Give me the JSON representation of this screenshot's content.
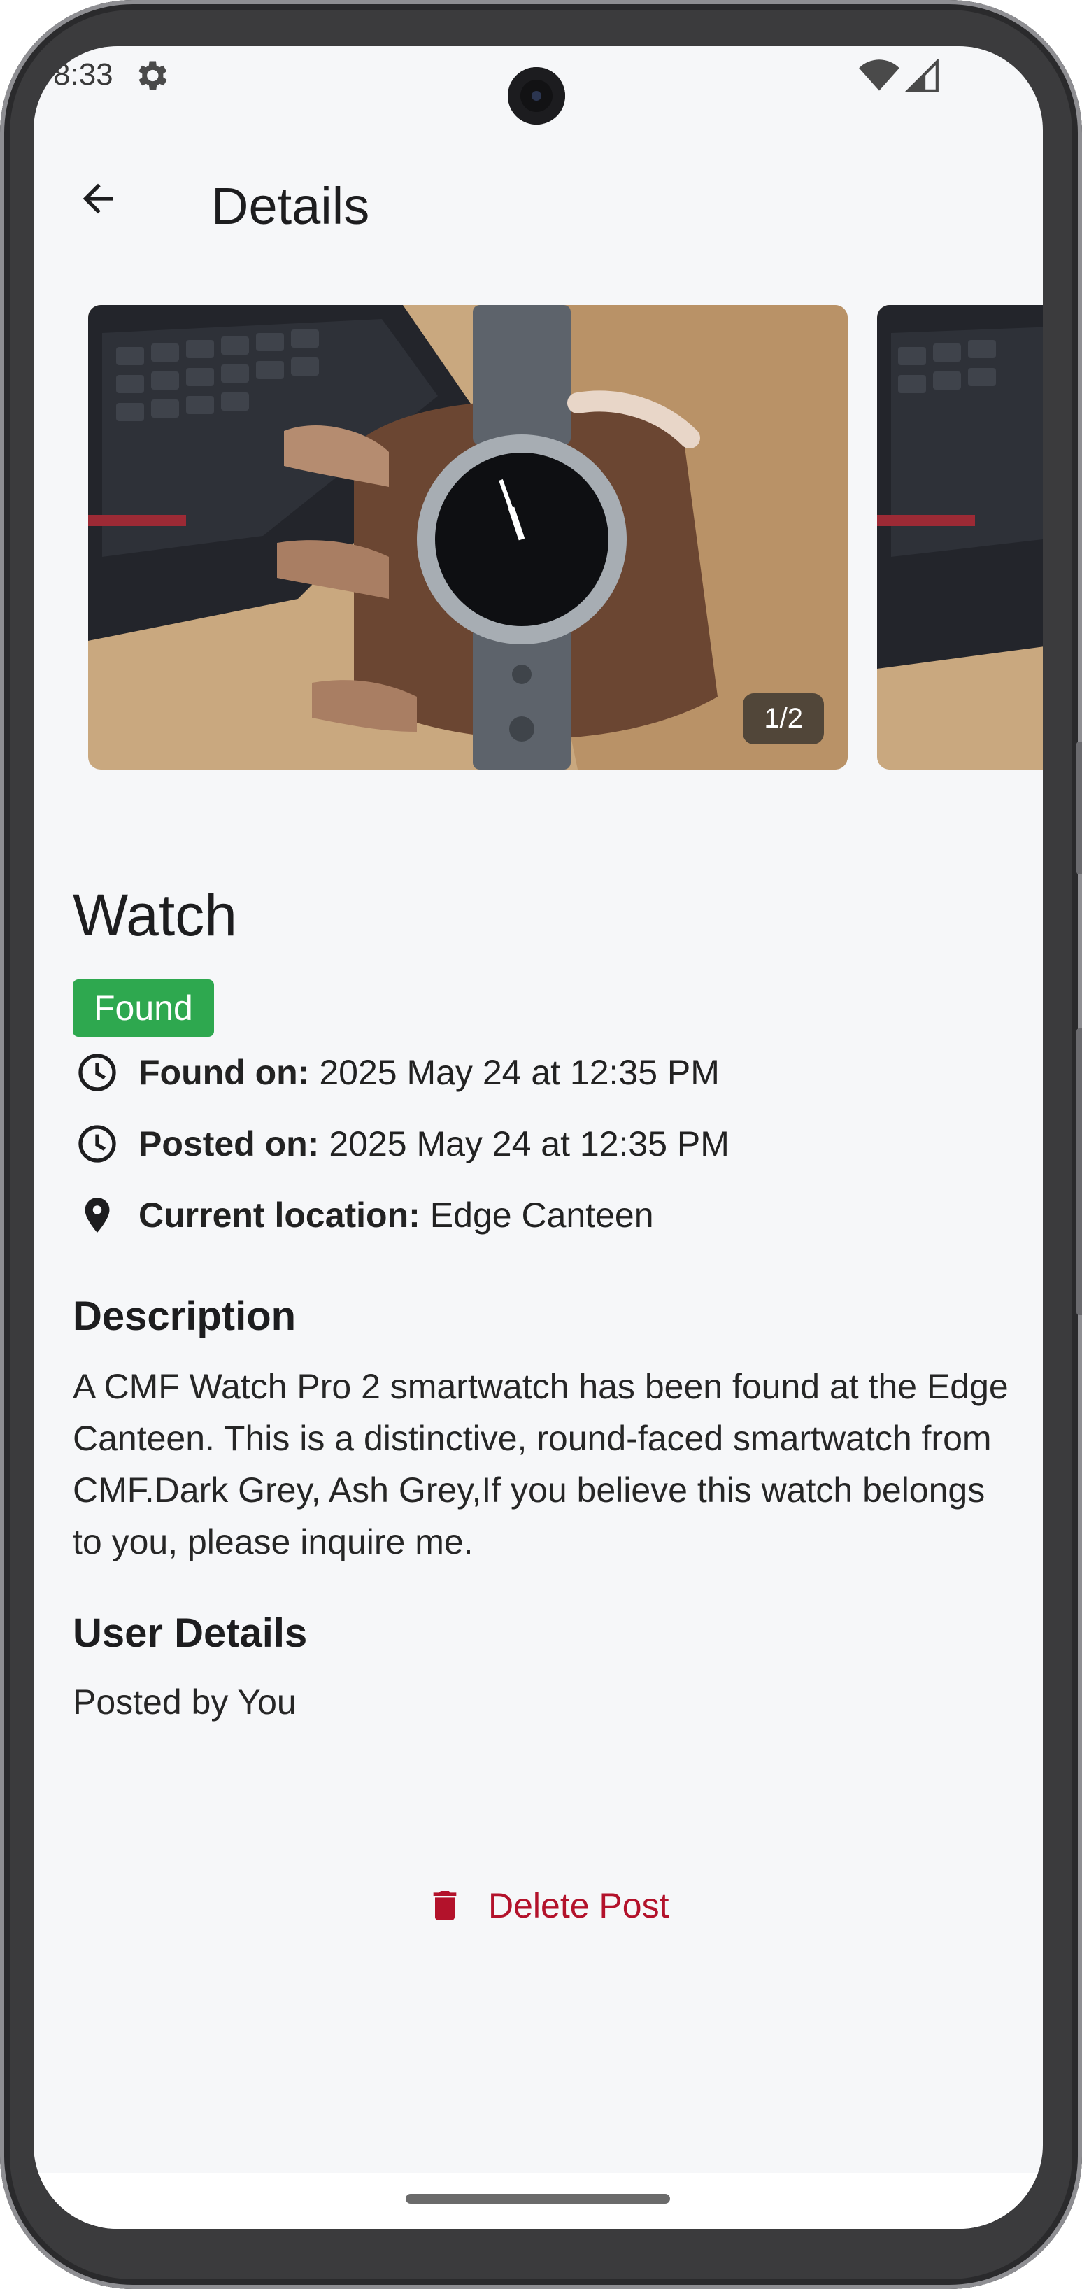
{
  "status_bar": {
    "time": "8:33",
    "icons": [
      "settings-gear-icon",
      "wifi-icon",
      "cell-signal-icon"
    ]
  },
  "app_bar": {
    "title": "Details",
    "back_icon": "arrow-back-icon"
  },
  "carousel": {
    "counter": "1/2",
    "current_index": 1,
    "total_images": 2
  },
  "item": {
    "title": "Watch",
    "status": "Found",
    "status_color": "#2ea84f",
    "found_on_label": "Found on:",
    "found_on_value": "2025 May 24 at 12:35 PM",
    "posted_on_label": "Posted on:",
    "posted_on_value": "2025 May 24 at 12:35 PM",
    "location_label": "Current location:",
    "location_value": "Edge Canteen"
  },
  "description": {
    "heading": "Description",
    "text": "A CMF Watch Pro 2 smartwatch has been found at the Edge Canteen. This is a distinctive, round-faced smartwatch from CMF.Dark Grey, Ash Grey,If you believe this watch belongs to you, please inquire me."
  },
  "user_details": {
    "heading": "User Details",
    "text": "Posted by You"
  },
  "actions": {
    "delete_label": "Delete Post",
    "delete_color": "#b3122b"
  }
}
